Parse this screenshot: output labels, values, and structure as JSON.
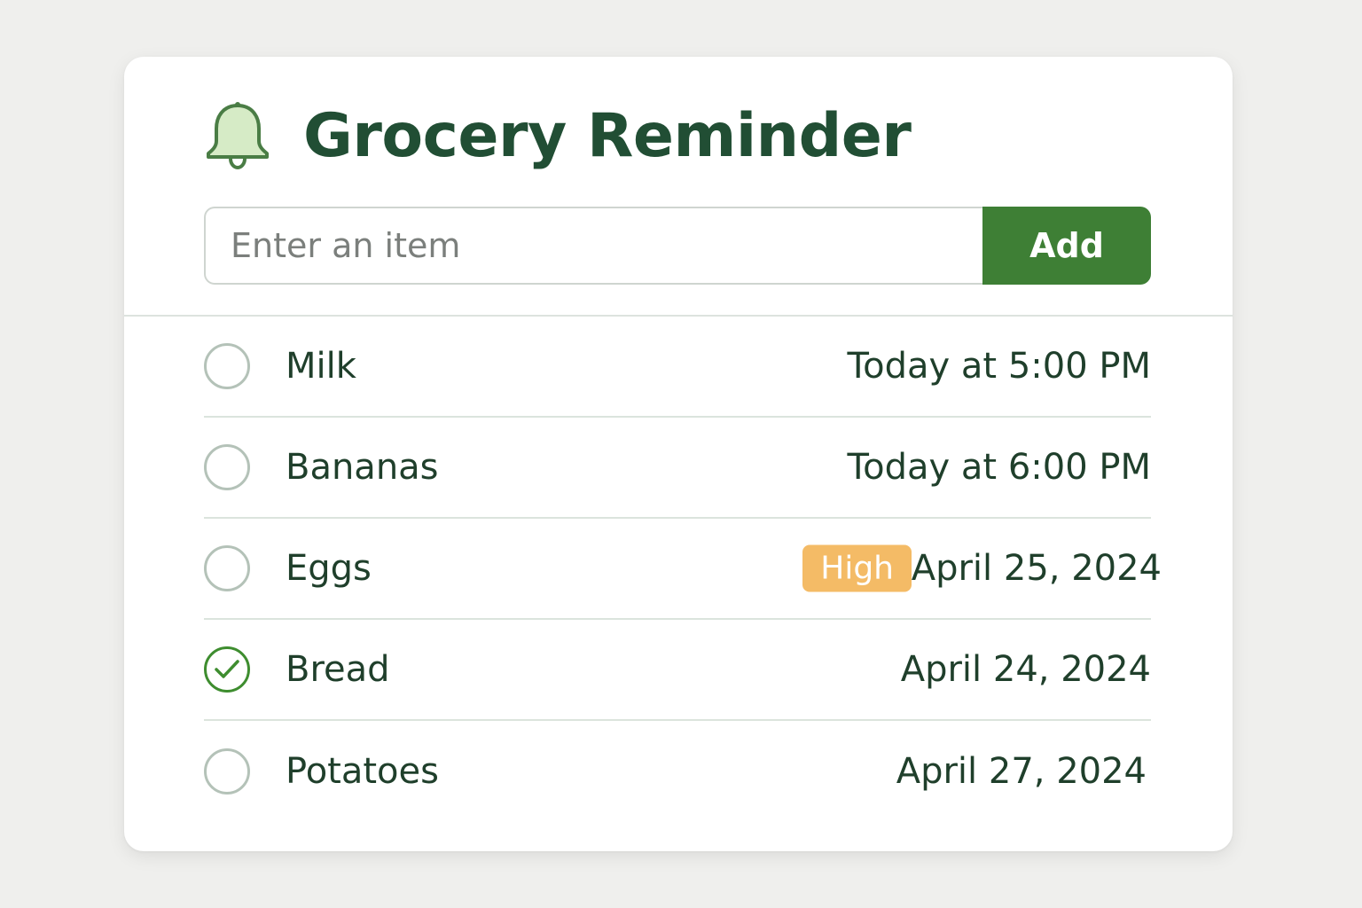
{
  "app": {
    "title": "Grocery Reminder",
    "icon": "bell-icon"
  },
  "add_form": {
    "placeholder": "Enter an item",
    "value": "",
    "button_label": "Add"
  },
  "colors": {
    "brand_green": "#3e7f35",
    "title_green": "#214e34",
    "priority_high": "#f4bb66"
  },
  "items": [
    {
      "name": "Milk",
      "due": "Today at 5:00 PM",
      "completed": false,
      "priority": ""
    },
    {
      "name": "Bananas",
      "due": "Today at 6:00 PM",
      "completed": false,
      "priority": ""
    },
    {
      "name": "Eggs",
      "due": "April 25, 2024",
      "completed": false,
      "priority": "High"
    },
    {
      "name": "Bread",
      "due": "April 24, 2024",
      "completed": true,
      "priority": ""
    },
    {
      "name": "Potatoes",
      "due": "April 27, 2024",
      "completed": false,
      "priority": ""
    }
  ]
}
